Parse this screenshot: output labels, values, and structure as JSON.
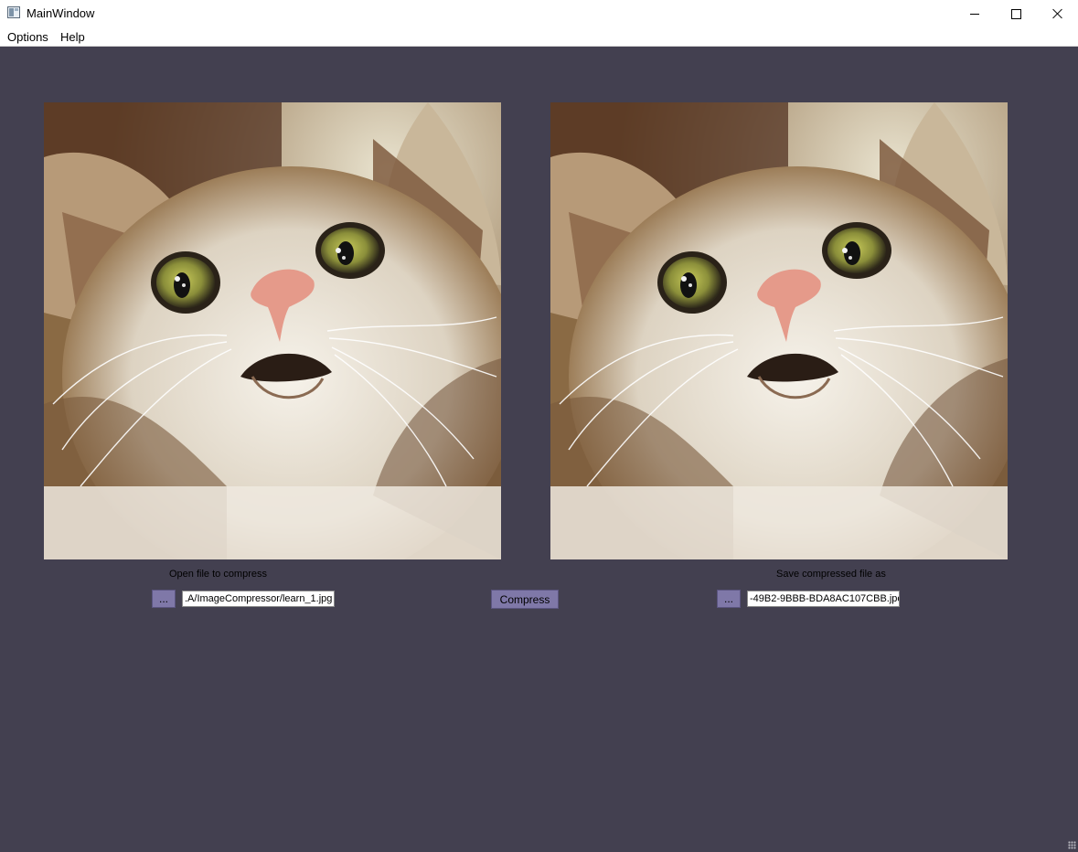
{
  "window": {
    "title": "MainWindow",
    "icons": {
      "app": "app-window-icon",
      "minimize": "minimize-icon",
      "maximize": "maximize-icon",
      "close": "close-icon"
    }
  },
  "menu": {
    "items": [
      {
        "label": "Options"
      },
      {
        "label": "Help"
      }
    ]
  },
  "source": {
    "caption": "Open file to compress",
    "browse_label": "...",
    "path_value": ".A/ImageCompressor/learn_1.jpg"
  },
  "actions": {
    "compress_label": "Compress"
  },
  "output": {
    "caption": "Save compressed file as",
    "browse_label": "...",
    "path_value": "-49B2-9BBB-BDA8AC107CBB.jpeg"
  },
  "colors": {
    "background": "#434050",
    "button": "#7f78a8"
  }
}
